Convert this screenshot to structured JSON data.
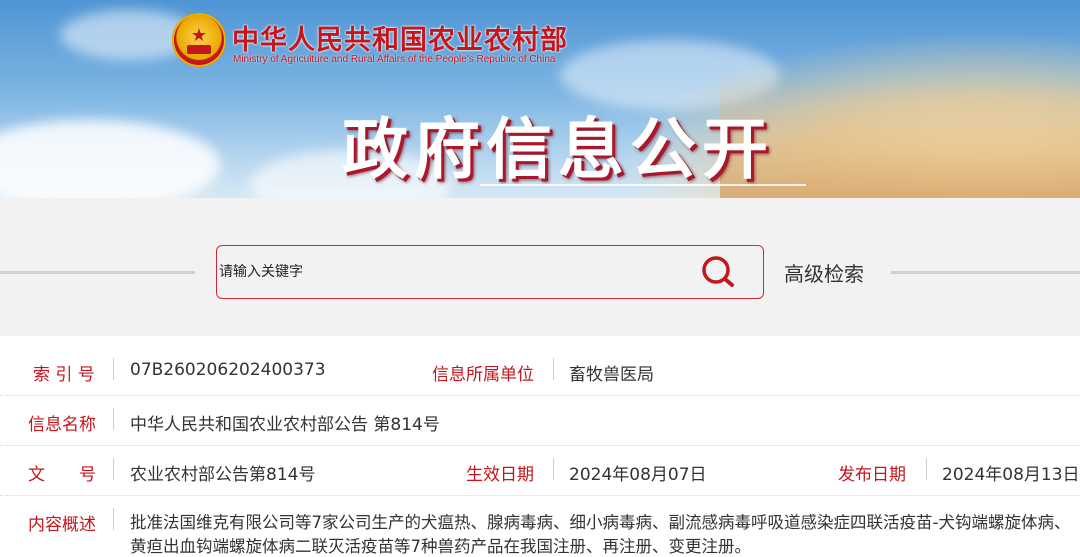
{
  "header": {
    "ministry_cn": "中华人民共和国农业农村部",
    "ministry_en": "Ministry of Agriculture and Rural Affairs of the People's Republic of China",
    "page_title": "政府信息公开"
  },
  "search": {
    "placeholder": "请输入关键字",
    "search_icon": "search-icon",
    "advanced_label": "高级检索"
  },
  "info": {
    "index_label": "索 引 号",
    "index_value": "07B260206202400373",
    "unit_label": "信息所属单位",
    "unit_value": "畜牧兽医局",
    "name_label": "信息名称",
    "name_value": "中华人民共和国农业农村部公告 第814号",
    "doc_label": "文　　号",
    "doc_value": "农业农村部公告第814号",
    "effective_label": "生效日期",
    "effective_value": "2024年08月07日",
    "publish_label": "发布日期",
    "publish_value": "2024年08月13日",
    "summary_label": "内容概述",
    "summary_value": "批准法国维克有限公司等7家公司生产的犬瘟热、腺病毒病、细小病毒病、副流感病毒呼吸道感染症四联活疫苗-犬钩端螺旋体病、黄疸出血钩端螺旋体病二联灭活疫苗等7种兽药产品在我国注册、再注册、变更注册。"
  },
  "colors": {
    "accent_red": "#c4161c",
    "label_red": "#c4161c",
    "text": "#333333"
  }
}
